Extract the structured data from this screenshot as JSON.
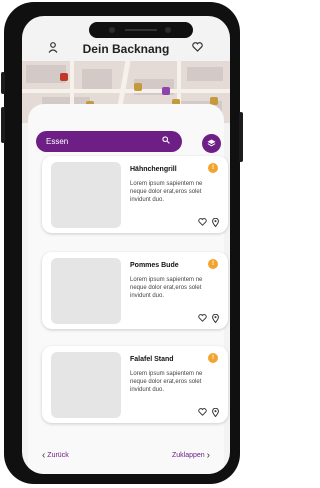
{
  "header": {
    "title": "Dein Backnang",
    "user_icon": "user-icon",
    "heart_icon": "heart-icon"
  },
  "search": {
    "placeholder": "Essen",
    "icon": "search-icon"
  },
  "layers_icon": "layers-icon",
  "colors": {
    "accent": "#6d1f86",
    "badge": "#f2a431"
  },
  "listings": [
    {
      "name": "Hähnchengrill",
      "description": "Lorem ipsum sapientem ne neque dolor erat,eros solet invidunt duo.",
      "badge": "!"
    },
    {
      "name": "Pommes Bude",
      "description": "Lorem ipsum sapientem ne neque dolor erat,eros solet invidunt duo.",
      "badge": "!"
    },
    {
      "name": "Falafel Stand",
      "description": "Lorem ipsum sapientem ne neque dolor erat,eros solet invidunt duo.",
      "badge": "!"
    }
  ],
  "footer": {
    "back_label": "Zurück",
    "next_label": "Zuklappen"
  }
}
